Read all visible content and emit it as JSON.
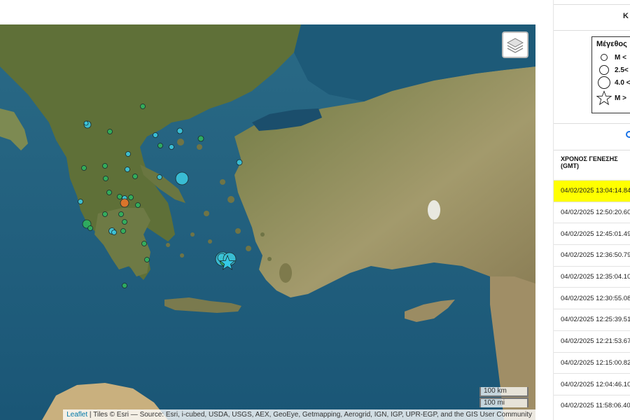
{
  "panel": {
    "top_text": "Κ",
    "legend": {
      "title": "Μέγεθος",
      "rows": [
        "M <",
        "2.5<",
        "4.0 <",
        "M >"
      ]
    },
    "table": {
      "header_line1": "ΧΡΟΝΟΣ ΓΕΝΕΣΗΣ",
      "header_line2": "(GMT)",
      "highlight_color": "#ffff00",
      "rows": [
        "04/02/2025 13:04:14.84",
        "04/02/2025 12:50:20.60",
        "04/02/2025 12:45:01.49",
        "04/02/2025 12:36:50.79",
        "04/02/2025 12:35:04.10",
        "04/02/2025 12:30:55.08",
        "04/02/2025 12:25:39.51",
        "04/02/2025 12:21:53.67",
        "04/02/2025 12:15:00.82",
        "04/02/2025 12:04:46.10",
        "04/02/2025 11:58:06.40"
      ]
    }
  },
  "map": {
    "layers_icon": "layers-icon",
    "scale_km": "100 km",
    "scale_mi": "100 mi",
    "attribution_link": "Leaflet",
    "attribution_text": " | Tiles © Esri — Source: Esri, i-cubed, USDA, USGS, AEX, GeoEye, Getmapping, Aerogrid, IGN, IGP, UPR-EGP, and the GIS User Community",
    "colors": {
      "sea": "#1f5f7c",
      "land": "#8a8f5a",
      "green_marker": "#2fb35e",
      "cyan_marker": "#3cc6dd",
      "orange_marker": "#e8762a",
      "star_marker": "#36c9e6"
    }
  }
}
